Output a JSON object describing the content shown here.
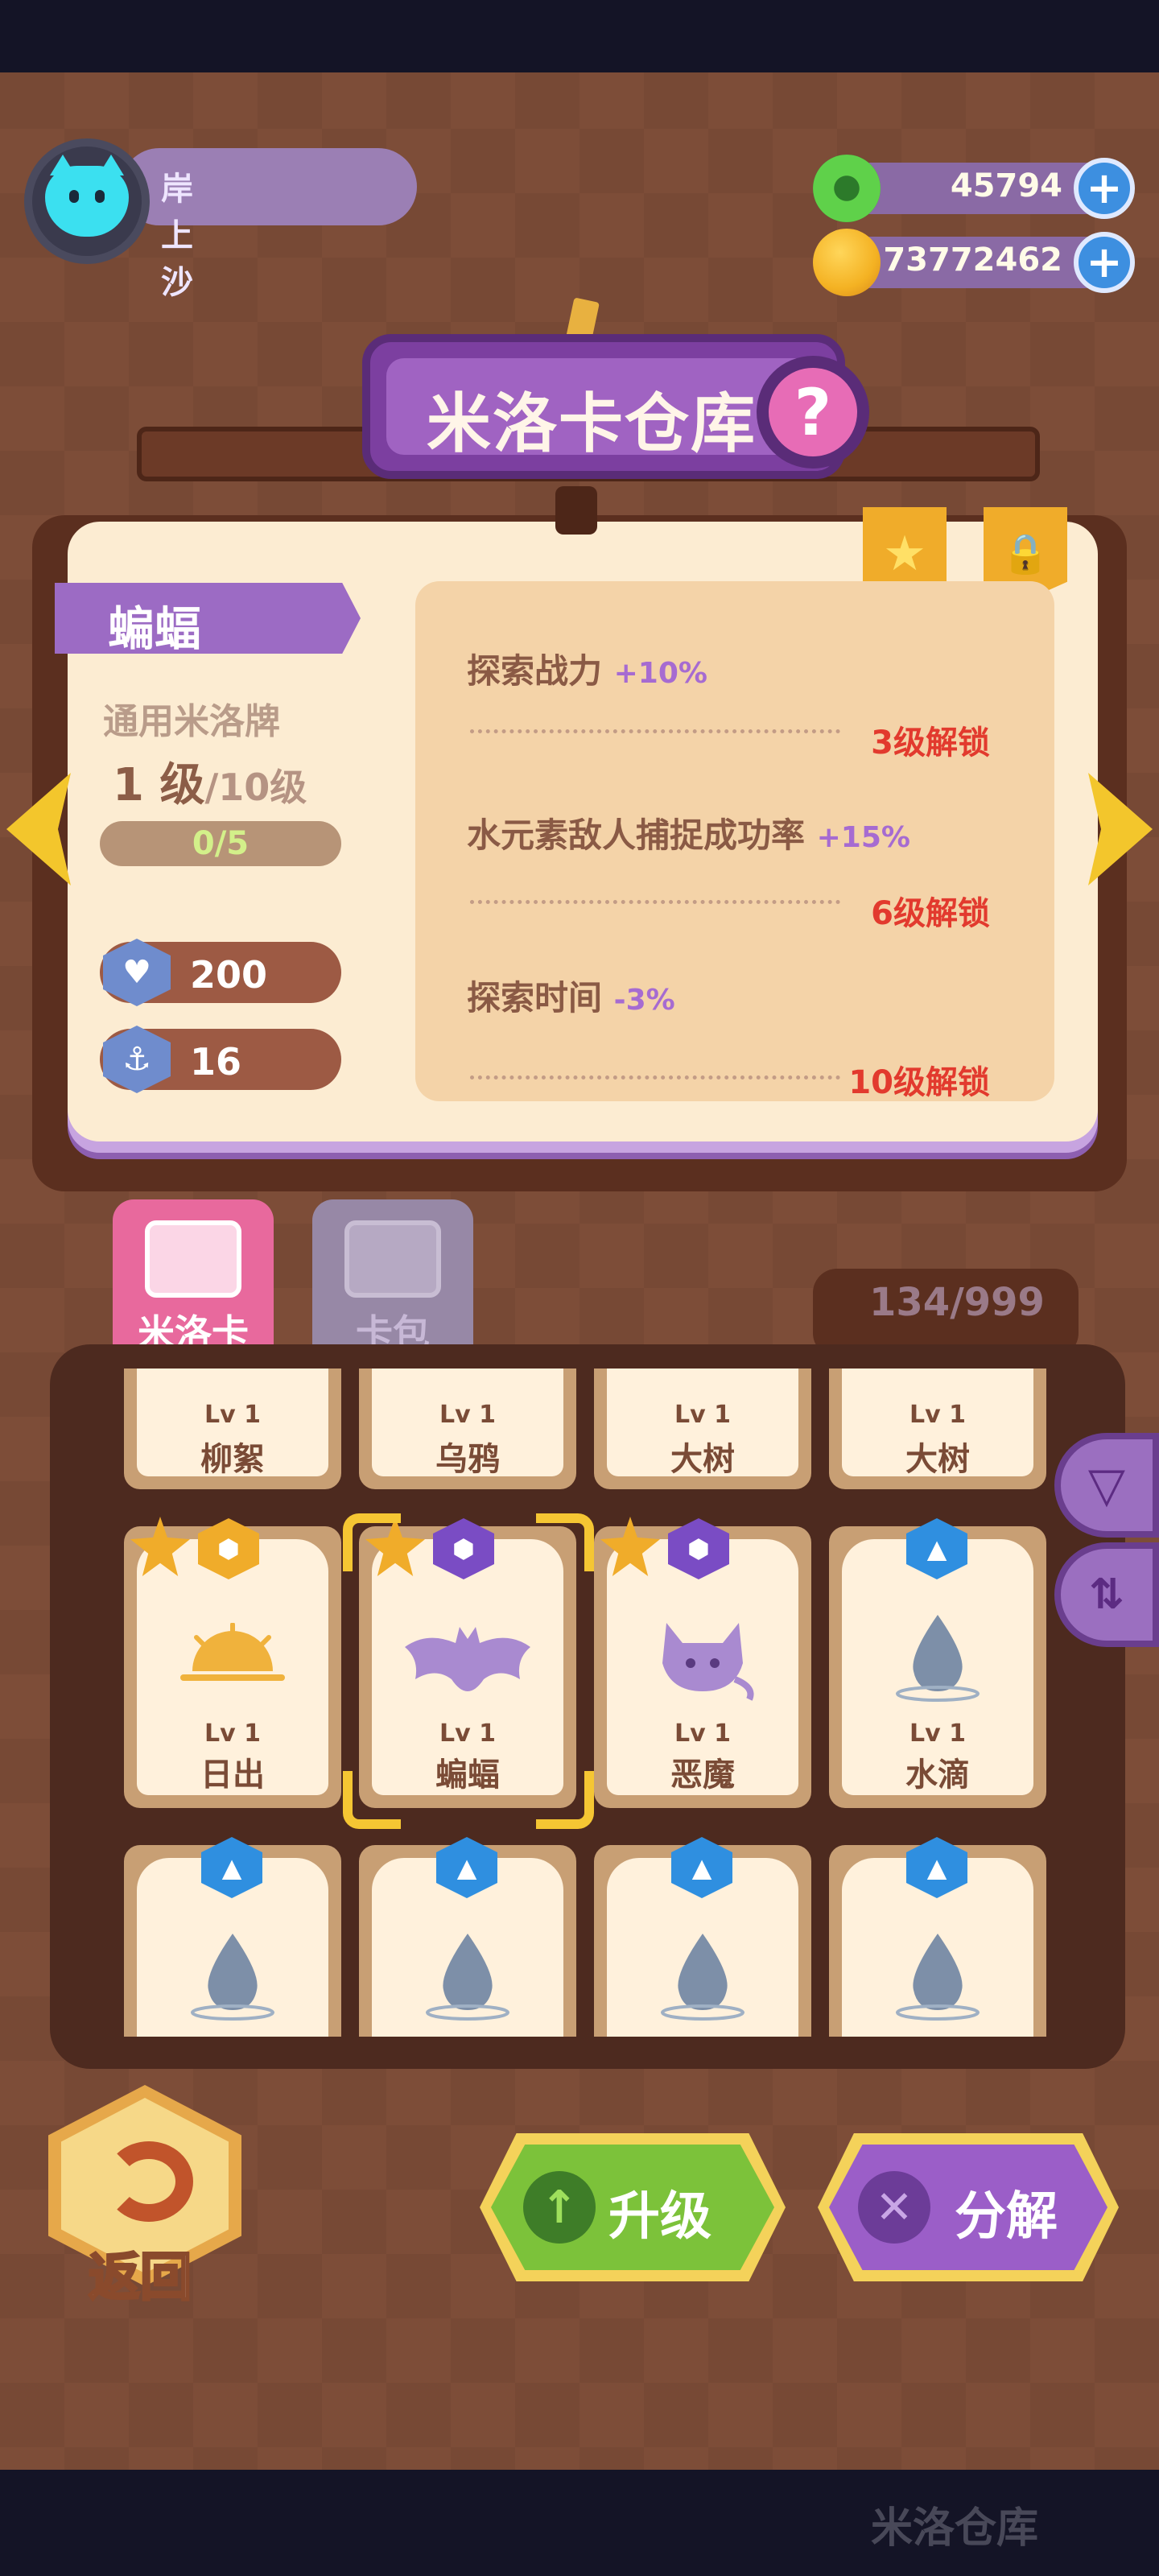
{
  "player": {
    "name": "岸上沙"
  },
  "currency": [
    {
      "name": "green-gem",
      "value": "45794",
      "color": "#5fd14a"
    },
    {
      "name": "gold-coin",
      "value": "73772462",
      "color": "#f4b223"
    }
  ],
  "title": "米洛卡仓库",
  "help_label": "?",
  "selected_card": {
    "name": "蝙蝠",
    "type": "通用米洛牌",
    "level": "1",
    "level_unit": "级",
    "level_max": "/10级",
    "exp_text": "0/5",
    "exp_fraction": 0,
    "stats": [
      {
        "icon": "heart-shield-icon",
        "value": "200"
      },
      {
        "icon": "anchor-shield-icon",
        "value": "16"
      }
    ],
    "attributes": [
      {
        "label": "探索战力",
        "bonus": "+10%",
        "unlock": "3级解锁"
      },
      {
        "label": "水元素敌人捕捉成功率",
        "bonus": "+15%",
        "unlock": "6级解锁"
      },
      {
        "label": "探索时间",
        "bonus": "-3%",
        "unlock": "10级解锁"
      }
    ]
  },
  "tabs": [
    {
      "label": "米洛卡",
      "active": true
    },
    {
      "label": "卡包",
      "active": false
    }
  ],
  "card_count": "134/999",
  "cards_row1": [
    {
      "lv": "Lv 1",
      "name": "柳絮"
    },
    {
      "lv": "Lv 1",
      "name": "乌鸦"
    },
    {
      "lv": "Lv 1",
      "name": "大树"
    },
    {
      "lv": "Lv 1",
      "name": "大树"
    }
  ],
  "cards_row2": [
    {
      "lv": "Lv 1",
      "name": "日出",
      "badge": "gold",
      "star": true
    },
    {
      "lv": "Lv 1",
      "name": "蝙蝠",
      "badge": "purple",
      "star": true,
      "selected": true
    },
    {
      "lv": "Lv 1",
      "name": "恶魔",
      "badge": "purple",
      "star": true
    },
    {
      "lv": "Lv 1",
      "name": "水滴",
      "badge": "blue",
      "star": false
    }
  ],
  "cards_row3": [
    {
      "name": "water-drop",
      "badge": "blue"
    },
    {
      "name": "water-drop",
      "badge": "blue"
    },
    {
      "name": "water-drop",
      "badge": "blue"
    },
    {
      "name": "water-drop",
      "badge": "blue"
    }
  ],
  "buttons": {
    "back": "返回",
    "upgrade": "升级",
    "decompose": "分解"
  },
  "navbar_ghost": "米洛仓库",
  "colors": {
    "badge_gold": "#f0ac2a",
    "badge_purple": "#7a4cc4",
    "badge_blue": "#2f8fe0",
    "upgrade_green": "#7cc23a",
    "decompose_purple": "#9b5ec8"
  }
}
